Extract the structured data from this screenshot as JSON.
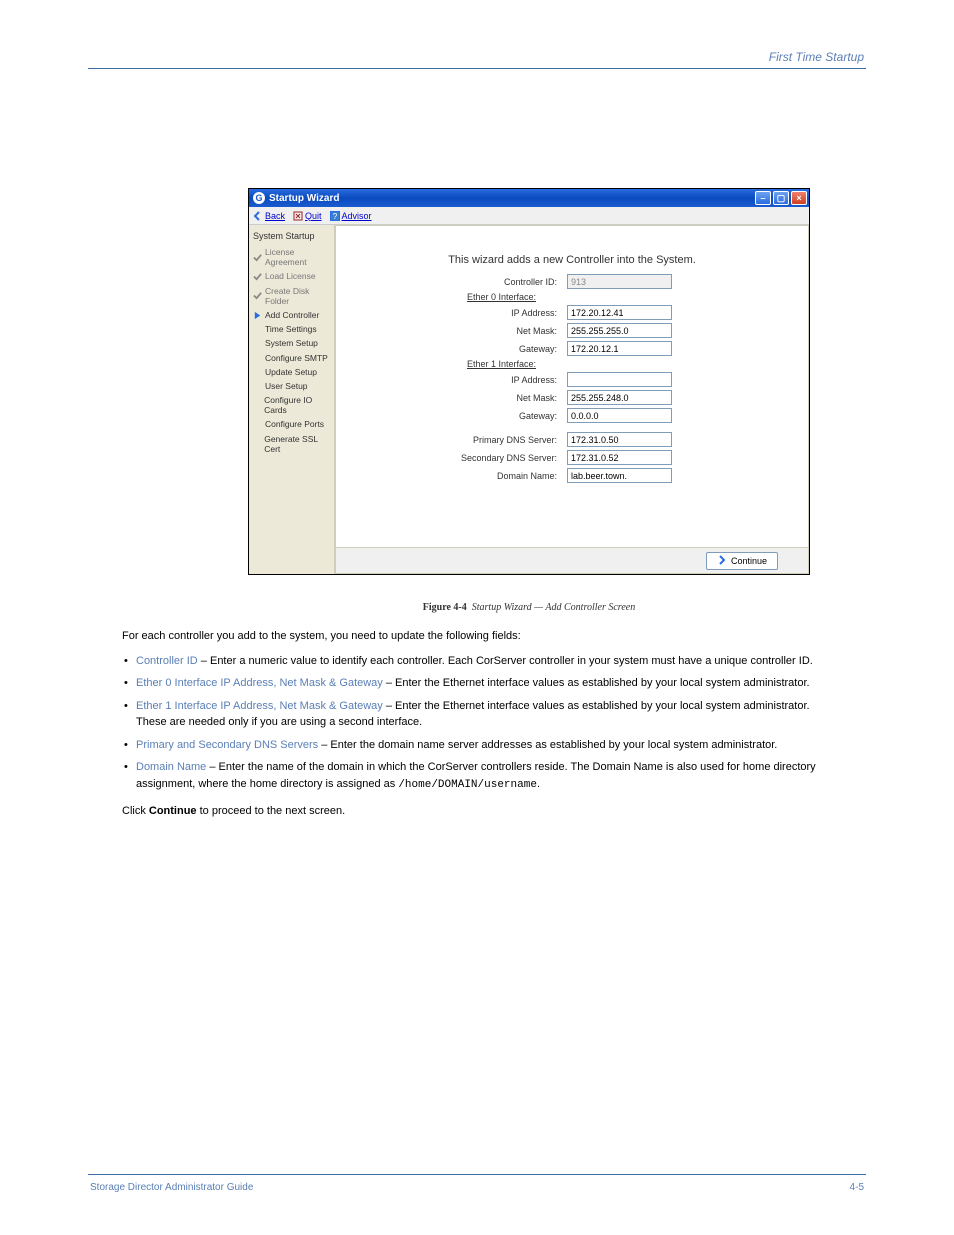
{
  "doc": {
    "header_right": "First Time Startup",
    "caption_prefix": "Figure 4-4",
    "caption_text": "Startup Wizard — Add Controller Screen",
    "para1": "For each controller you add to the system, you need to update the following fields:",
    "bullets": [
      {
        "label": "Controller ID",
        "after": " – Enter a numeric value to identify each controller. Each CorServer controller in your system must have a unique controller ID."
      },
      {
        "label": "Ether 0 Interface IP Address, Net Mask & Gateway",
        "after": " – Enter the Ethernet interface values as established by your local system administrator."
      },
      {
        "label": "Ether 1 Interface IP Address, Net Mask & Gateway",
        "after": " – Enter the Ethernet interface values as established by your local system administrator. These are needed only if you are using a second interface."
      },
      {
        "label": "Primary and Secondary DNS Servers",
        "after": " – Enter the domain name server addresses as established by your local system administrator."
      },
      {
        "label": "Domain Name",
        "after_html": " – Enter the name of the domain in which the CorServer controllers reside. The Domain Name is also used for home directory assignment, where the home directory is assigned as <span class='cmd'>/home/DOMAIN/username</span>."
      }
    ],
    "para2_html": "Click <b>Continue</b> to proceed to the next screen."
  },
  "footer": {
    "left": "Storage Director Administrator Guide",
    "right": "4-5"
  },
  "window": {
    "title": "Startup Wizard",
    "toolbar": {
      "back": "Back",
      "quit": "Quit",
      "advisor": "Advisor"
    },
    "sidebar": {
      "title": "System Startup",
      "items": [
        {
          "label": "License Agreement",
          "state": "done"
        },
        {
          "label": "Load License",
          "state": "done"
        },
        {
          "label": "Create Disk Folder",
          "state": "done"
        },
        {
          "label": "Add Controller",
          "state": "current"
        },
        {
          "label": "Time Settings",
          "state": "pending"
        },
        {
          "label": "System Setup",
          "state": "pending"
        },
        {
          "label": "Configure SMTP",
          "state": "pending"
        },
        {
          "label": "Update Setup",
          "state": "pending"
        },
        {
          "label": "User Setup",
          "state": "pending"
        },
        {
          "label": "Configure IO Cards",
          "state": "pending"
        },
        {
          "label": "Configure Ports",
          "state": "pending"
        },
        {
          "label": "Generate SSL Cert",
          "state": "pending"
        }
      ]
    },
    "main": {
      "heading": "This wizard adds a new Controller into the System.",
      "controller_id_label": "Controller ID:",
      "controller_id_value": "913",
      "ether0_header": "Ether 0 Interface:",
      "ether1_header": "Ether 1 Interface:",
      "ip_label": "IP Address:",
      "netmask_label": "Net Mask:",
      "gateway_label": "Gateway:",
      "ether0_ip": "172.20.12.41",
      "ether0_netmask": "255.255.255.0",
      "ether0_gateway": "172.20.12.1",
      "ether1_ip": "",
      "ether1_netmask": "255.255.248.0",
      "ether1_gateway": "0.0.0.0",
      "primary_dns_label": "Primary DNS Server:",
      "primary_dns_value": "172.31.0.50",
      "secondary_dns_label": "Secondary DNS Server:",
      "secondary_dns_value": "172.31.0.52",
      "domain_label": "Domain Name:",
      "domain_value": "lab.beer.town.",
      "continue_btn": "Continue"
    }
  }
}
